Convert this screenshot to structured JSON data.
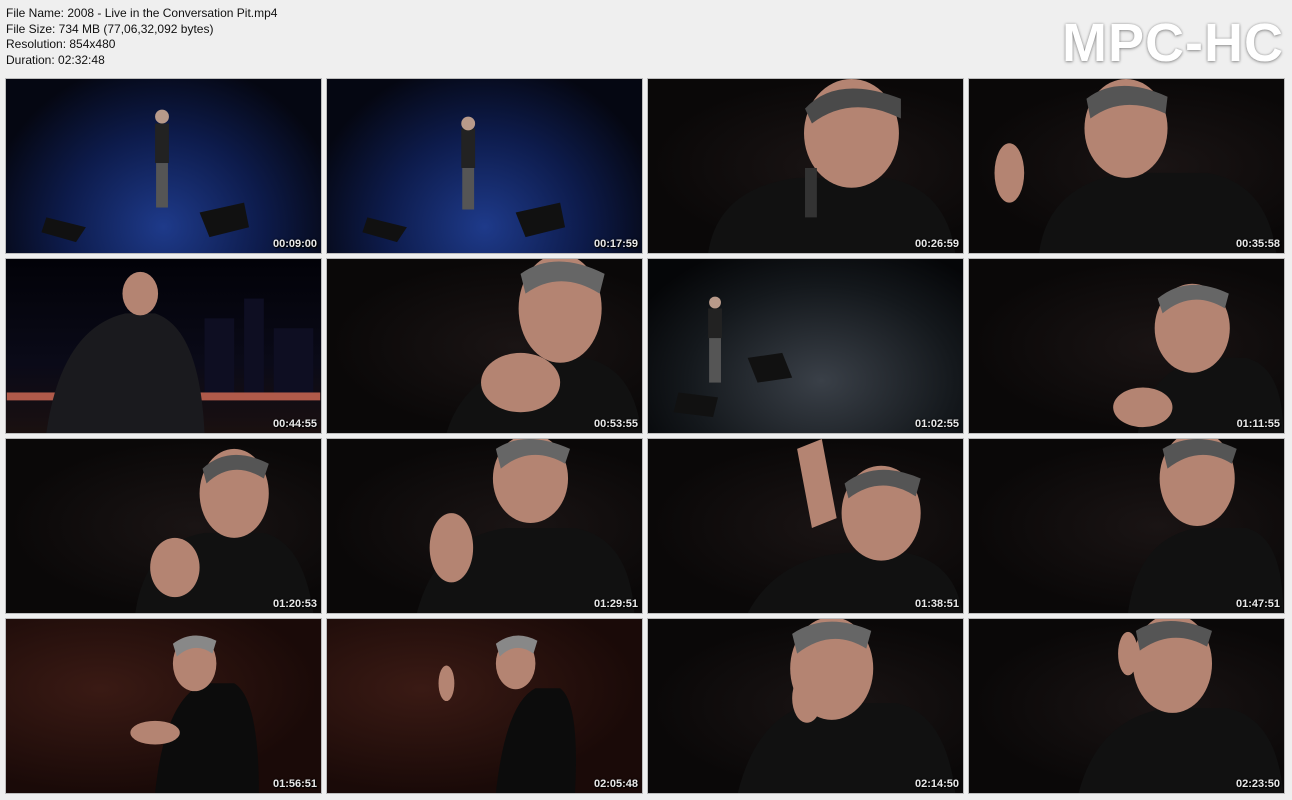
{
  "info": {
    "file_name": "File Name: 2008 - Live in the Conversation Pit.mp4",
    "file_size": "File Size: 734 MB (77,06,32,092 bytes)",
    "resolution": "Resolution: 854x480",
    "duration": "Duration: 02:32:48"
  },
  "logo": "MPC-HC",
  "thumbnails": [
    {
      "timestamp": "00:09:00",
      "scene": "stage-blue"
    },
    {
      "timestamp": "00:17:59",
      "scene": "stage-blue"
    },
    {
      "timestamp": "00:26:59",
      "scene": "closeup"
    },
    {
      "timestamp": "00:35:58",
      "scene": "closeup"
    },
    {
      "timestamp": "00:44:55",
      "scene": "city"
    },
    {
      "timestamp": "00:53:55",
      "scene": "closeup"
    },
    {
      "timestamp": "01:02:55",
      "scene": "stage-grey"
    },
    {
      "timestamp": "01:11:55",
      "scene": "closeup"
    },
    {
      "timestamp": "01:20:53",
      "scene": "closeup"
    },
    {
      "timestamp": "01:29:51",
      "scene": "closeup"
    },
    {
      "timestamp": "01:38:51",
      "scene": "closeup"
    },
    {
      "timestamp": "01:47:51",
      "scene": "closeup"
    },
    {
      "timestamp": "01:56:51",
      "scene": "crowd"
    },
    {
      "timestamp": "02:05:48",
      "scene": "crowd"
    },
    {
      "timestamp": "02:14:50",
      "scene": "closeup"
    },
    {
      "timestamp": "02:23:50",
      "scene": "closeup"
    }
  ]
}
